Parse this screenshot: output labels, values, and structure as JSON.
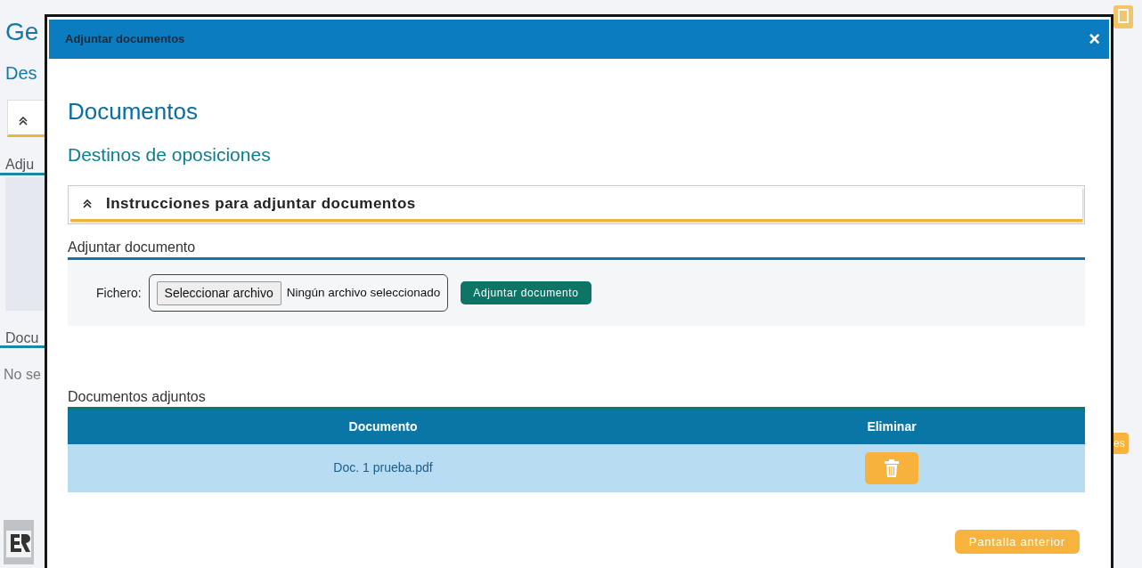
{
  "background": {
    "title": "Ge",
    "subtitle": "Des",
    "section_1": "Adju",
    "section_2": "Docu",
    "message": "No se",
    "button": "es"
  },
  "dialog": {
    "title": "Adjuntar documentos",
    "close": "×"
  },
  "heading": "Documentos",
  "subheading": "Destinos de oposiciones",
  "instructions": {
    "title": "Instrucciones para adjuntar documentos"
  },
  "upload": {
    "title": "Adjuntar documento",
    "label": "Fichero:",
    "file_button": "Seleccionar archivo",
    "file_status": "Ningún archivo seleccionado",
    "submit": "Adjuntar documento"
  },
  "attachments": {
    "title": "Documentos adjuntos",
    "columns": [
      "Documento",
      "Eliminar"
    ],
    "rows": [
      {
        "name": "Doc. 1 prueba.pdf"
      }
    ]
  },
  "back_button": "Pantalla anterior"
}
